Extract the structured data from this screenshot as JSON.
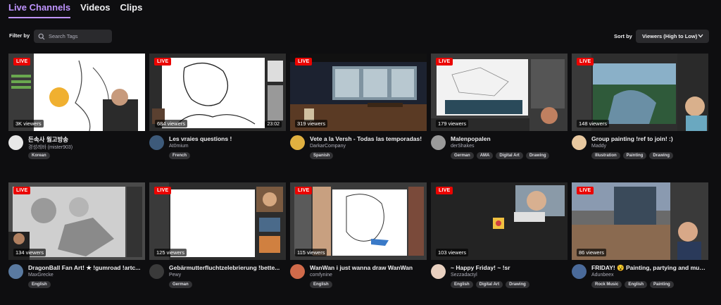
{
  "tabs": [
    {
      "label": "Live Channels",
      "active": true
    },
    {
      "label": "Videos",
      "active": false
    },
    {
      "label": "Clips",
      "active": false
    }
  ],
  "filter": {
    "label": "Filter by",
    "search_placeholder": "Search Tags"
  },
  "sort": {
    "label": "Sort by",
    "selected": "Viewers (High to Low)"
  },
  "cards": [
    {
      "title": "든속사 웜고방송",
      "channel": "경성레바 (mister903)",
      "viewers": "3K viewers",
      "tags": [
        "Korean"
      ],
      "duration": ""
    },
    {
      "title": "Les vraies questions !",
      "channel": "At0mium",
      "viewers": "684 viewers",
      "tags": [
        "French"
      ],
      "duration": "23:02"
    },
    {
      "title": "Vete a la Versh - Todas las temporadas!",
      "channel": "DarkarCompany",
      "viewers": "319 viewers",
      "tags": [
        "Spanish"
      ],
      "duration": ""
    },
    {
      "title": "Malenpopalen",
      "channel": "derShakes",
      "viewers": "179 viewers",
      "tags": [
        "German",
        "AMA",
        "Digital Art",
        "Drawing"
      ],
      "duration": ""
    },
    {
      "title": "Group painting !ref to join! :)",
      "channel": "Maddy",
      "viewers": "148 viewers",
      "tags": [
        "Illustration",
        "Painting",
        "Drawing"
      ],
      "duration": ""
    },
    {
      "title": "DragonBall Fan Art! ★ !gumroad !artc...",
      "channel": "MaxGrecke",
      "viewers": "134 viewers",
      "tags": [
        "English"
      ],
      "duration": ""
    },
    {
      "title": "Gebärmutterfluchtzelebrierung !bette...",
      "channel": "Pewy",
      "viewers": "125 viewers",
      "tags": [
        "German"
      ],
      "duration": ""
    },
    {
      "title": "WanWan i just wanna draw WanWan",
      "channel": "comfynine",
      "viewers": "115 viewers",
      "tags": [
        "English"
      ],
      "duration": ""
    },
    {
      "title": "~ Happy Friday! ~ !sr",
      "channel": "Sezzadactyl",
      "viewers": "103 viewers",
      "tags": [
        "English",
        "Digital Art",
        "Drawing"
      ],
      "duration": ""
    },
    {
      "title": "FRIDAY! 😵 Painting, partying and musi...",
      "channel": "Adunbeex",
      "viewers": "86 viewers",
      "tags": [
        "Rock Music",
        "English",
        "Painting"
      ],
      "duration": ""
    }
  ],
  "live_label": "LIVE",
  "colors": {
    "accent": "#bf94ff",
    "live_badge": "#eb0400",
    "background": "#0e0e10"
  }
}
